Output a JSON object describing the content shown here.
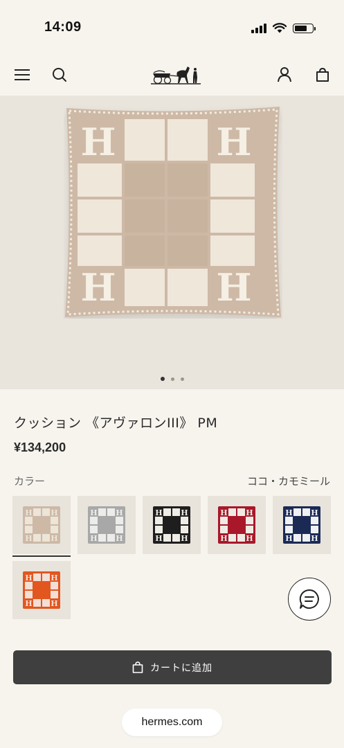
{
  "status_bar": {
    "time": "14:09"
  },
  "nav": {
    "menu_icon": "menu-icon",
    "search_icon": "search-icon",
    "logo": "hermes-carriage-logo",
    "account_icon": "user-icon",
    "bag_icon": "shopping-bag-icon"
  },
  "carousel": {
    "total": 3,
    "current": 1
  },
  "product": {
    "title": "クッション 《アヴァロンIII》 PM",
    "price": "¥134,200"
  },
  "color": {
    "label": "カラー",
    "selected_name": "ココ・カモミール",
    "swatches": [
      {
        "base": "#ece5d8",
        "accent": "#cdb9a6",
        "selected": true
      },
      {
        "base": "#ececea",
        "accent": "#a8a8a8",
        "selected": false
      },
      {
        "base": "#efece6",
        "accent": "#1e1e1e",
        "selected": false
      },
      {
        "base": "#efebe4",
        "accent": "#a8182a",
        "selected": false
      },
      {
        "base": "#eef0f3",
        "accent": "#1b2a55",
        "selected": false
      },
      {
        "base": "#f3dfd6",
        "accent": "#e2561f",
        "selected": false
      }
    ]
  },
  "chat": {
    "icon": "chat-bubble-icon"
  },
  "cart": {
    "label": "カートに追加",
    "icon": "shopping-bag-icon"
  },
  "browser": {
    "url": "hermes.com"
  },
  "colors": {
    "background": "#f7f4ee",
    "button": "#3f3f3f",
    "pillow_base": "#ece5d8",
    "pillow_accent": "#cdb9a6"
  }
}
